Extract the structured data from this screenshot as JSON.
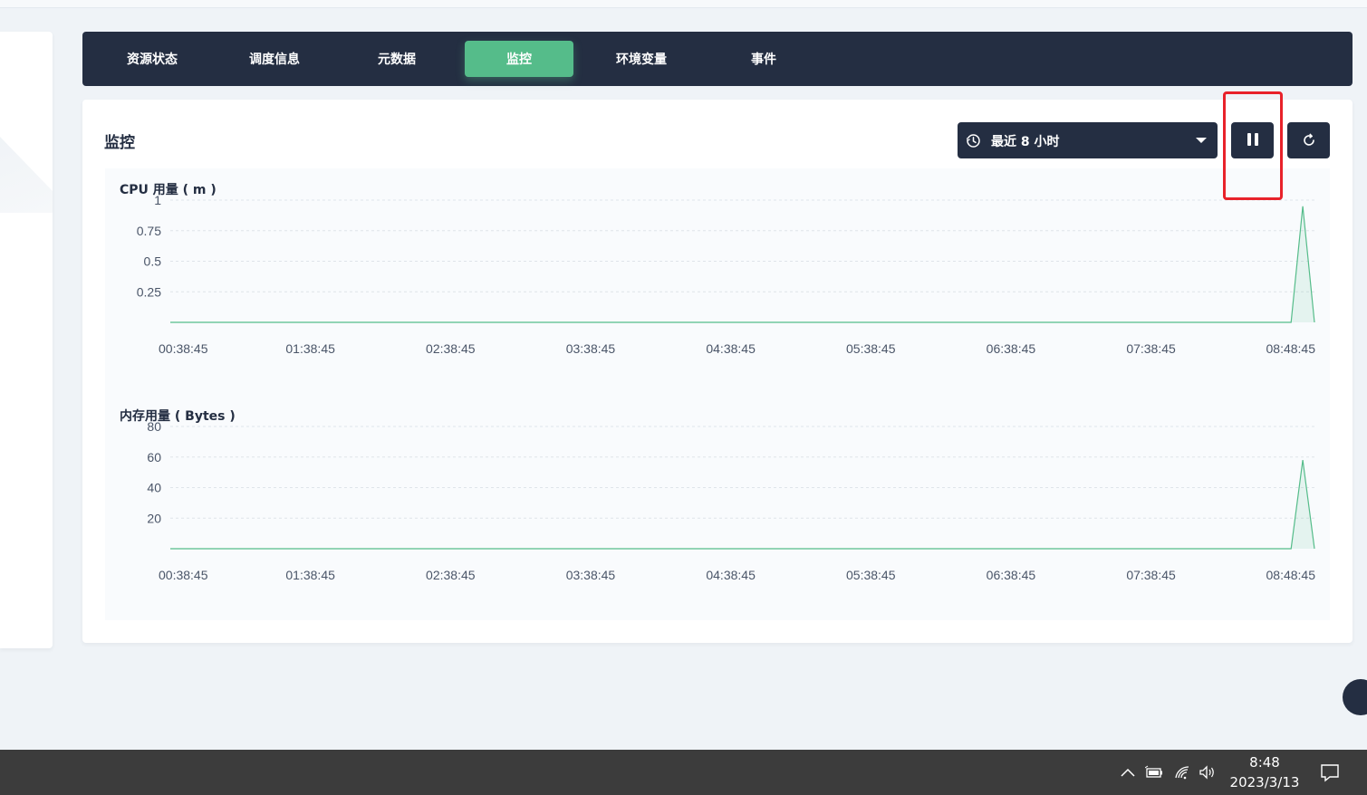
{
  "tabs": [
    {
      "label": "资源状态"
    },
    {
      "label": "调度信息"
    },
    {
      "label": "元数据"
    },
    {
      "label": "监控",
      "active": true
    },
    {
      "label": "环境变量"
    },
    {
      "label": "事件"
    }
  ],
  "panel": {
    "title": "监控",
    "time_range": "最近 8 小时",
    "icons": {
      "time": "clock-icon",
      "pause": "pause-icon",
      "refresh": "refresh-icon",
      "dropdown": "caret-down-icon"
    }
  },
  "colors": {
    "dark": "#242e42",
    "accent": "#55bc8a",
    "highlight": "#e8222a",
    "page_bg": "#eff3f7"
  },
  "chart_data": [
    {
      "type": "area",
      "title": "CPU 用量 ( m )",
      "x": [
        "00:38:45",
        "01:38:45",
        "02:38:45",
        "03:38:45",
        "04:38:45",
        "05:38:45",
        "06:38:45",
        "07:38:45",
        "08:48:45"
      ],
      "y_ticks": [
        "1",
        "0.75",
        "0.5",
        "0.25"
      ],
      "ylim": [
        0,
        1
      ],
      "grid": true,
      "series": [
        {
          "points": [
            {
              "x": "00:38:45",
              "y": 0
            },
            {
              "x": "08:38:45",
              "y": 0
            },
            {
              "x": "08:43:45",
              "y": 0.95
            },
            {
              "x": "08:48:45",
              "y": 0
            }
          ]
        }
      ]
    },
    {
      "type": "area",
      "title": "内存用量 ( Bytes )",
      "x": [
        "00:38:45",
        "01:38:45",
        "02:38:45",
        "03:38:45",
        "04:38:45",
        "05:38:45",
        "06:38:45",
        "07:38:45",
        "08:48:45"
      ],
      "y_ticks": [
        "80",
        "60",
        "40",
        "20"
      ],
      "ylim": [
        0,
        80
      ],
      "grid": true,
      "series": [
        {
          "points": [
            {
              "x": "00:38:45",
              "y": 0
            },
            {
              "x": "08:38:45",
              "y": 0
            },
            {
              "x": "08:43:45",
              "y": 58
            },
            {
              "x": "08:48:45",
              "y": 0
            }
          ]
        }
      ]
    }
  ],
  "taskbar": {
    "time": "8:48",
    "date": "2023/3/13",
    "icons": [
      "chevron-up-icon",
      "battery-icon",
      "wifi-icon",
      "volume-icon",
      "notification-icon"
    ]
  }
}
